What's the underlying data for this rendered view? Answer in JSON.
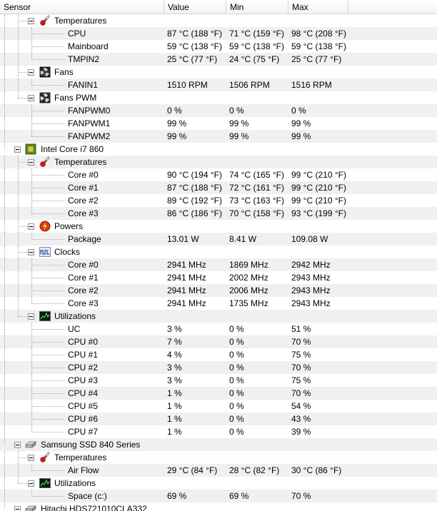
{
  "header": {
    "sensor": "Sensor",
    "value": "Value",
    "min": "Min",
    "max": "Max"
  },
  "rows": [
    {
      "type": "cat",
      "label": "Temperatures",
      "icon": "thermometer"
    },
    {
      "type": "leaf",
      "label": "CPU",
      "value": "87 °C  (188 °F)",
      "min": "71 °C  (159 °F)",
      "max": "98 °C  (208 °F)"
    },
    {
      "type": "leaf",
      "label": "Mainboard",
      "value": "59 °C  (138 °F)",
      "min": "59 °C  (138 °F)",
      "max": "59 °C  (138 °F)"
    },
    {
      "type": "leaf",
      "label": "TMPIN2",
      "value": "25 °C  (77 °F)",
      "min": "24 °C  (75 °F)",
      "max": "25 °C  (77 °F)",
      "last": true
    },
    {
      "type": "cat",
      "label": "Fans",
      "icon": "fan"
    },
    {
      "type": "leaf",
      "label": "FANIN1",
      "value": "1510 RPM",
      "min": "1506 RPM",
      "max": "1516 RPM",
      "last": true
    },
    {
      "type": "cat",
      "label": "Fans PWM",
      "icon": "fan-pwm",
      "lastCat": true
    },
    {
      "type": "leaf",
      "label": "FANPWM0",
      "value": "0 %",
      "min": "0 %",
      "max": "0 %"
    },
    {
      "type": "leaf",
      "label": "FANPWM1",
      "value": "99 %",
      "min": "99 %",
      "max": "99 %"
    },
    {
      "type": "leaf",
      "label": "FANPWM2",
      "value": "99 %",
      "min": "99 %",
      "max": "99 %",
      "last": true
    },
    {
      "type": "hw",
      "label": "Intel Core i7 860",
      "icon": "cpu-chip"
    },
    {
      "type": "cat",
      "label": "Temperatures",
      "icon": "thermometer"
    },
    {
      "type": "leaf",
      "label": "Core #0",
      "value": "90 °C  (194 °F)",
      "min": "74 °C  (165 °F)",
      "max": "99 °C  (210 °F)"
    },
    {
      "type": "leaf",
      "label": "Core #1",
      "value": "87 °C  (188 °F)",
      "min": "72 °C  (161 °F)",
      "max": "99 °C  (210 °F)"
    },
    {
      "type": "leaf",
      "label": "Core #2",
      "value": "89 °C  (192 °F)",
      "min": "73 °C  (163 °F)",
      "max": "99 °C  (210 °F)"
    },
    {
      "type": "leaf",
      "label": "Core #3",
      "value": "86 °C  (186 °F)",
      "min": "70 °C  (158 °F)",
      "max": "93 °C  (199 °F)",
      "last": true
    },
    {
      "type": "cat",
      "label": "Powers",
      "icon": "power"
    },
    {
      "type": "leaf",
      "label": "Package",
      "value": "13.01 W",
      "min": "8.41 W",
      "max": "109.08 W",
      "last": true
    },
    {
      "type": "cat",
      "label": "Clocks",
      "icon": "clock"
    },
    {
      "type": "leaf",
      "label": "Core #0",
      "value": "2941 MHz",
      "min": "1869 MHz",
      "max": "2942 MHz"
    },
    {
      "type": "leaf",
      "label": "Core #1",
      "value": "2941 MHz",
      "min": "2002 MHz",
      "max": "2943 MHz"
    },
    {
      "type": "leaf",
      "label": "Core #2",
      "value": "2941 MHz",
      "min": "2006 MHz",
      "max": "2943 MHz"
    },
    {
      "type": "leaf",
      "label": "Core #3",
      "value": "2941 MHz",
      "min": "1735 MHz",
      "max": "2943 MHz",
      "last": true
    },
    {
      "type": "cat",
      "label": "Utilizations",
      "icon": "load",
      "lastCat": true
    },
    {
      "type": "leaf",
      "label": "UC",
      "value": "3 %",
      "min": "0 %",
      "max": "51 %"
    },
    {
      "type": "leaf",
      "label": "CPU #0",
      "value": "7 %",
      "min": "0 %",
      "max": "70 %"
    },
    {
      "type": "leaf",
      "label": "CPU #1",
      "value": "4 %",
      "min": "0 %",
      "max": "75 %"
    },
    {
      "type": "leaf",
      "label": "CPU #2",
      "value": "3 %",
      "min": "0 %",
      "max": "70 %"
    },
    {
      "type": "leaf",
      "label": "CPU #3",
      "value": "3 %",
      "min": "0 %",
      "max": "75 %"
    },
    {
      "type": "leaf",
      "label": "CPU #4",
      "value": "1 %",
      "min": "0 %",
      "max": "70 %"
    },
    {
      "type": "leaf",
      "label": "CPU #5",
      "value": "1 %",
      "min": "0 %",
      "max": "54 %"
    },
    {
      "type": "leaf",
      "label": "CPU #6",
      "value": "1 %",
      "min": "0 %",
      "max": "43 %"
    },
    {
      "type": "leaf",
      "label": "CPU #7",
      "value": "1 %",
      "min": "0 %",
      "max": "39 %",
      "last": true
    },
    {
      "type": "hw",
      "label": "Samsung SSD 840 Series",
      "icon": "drive"
    },
    {
      "type": "cat",
      "label": "Temperatures",
      "icon": "thermometer"
    },
    {
      "type": "leaf",
      "label": "Air Flow",
      "value": "29 °C  (84 °F)",
      "min": "28 °C  (82 °F)",
      "max": "30 °C  (86 °F)",
      "last": true
    },
    {
      "type": "cat",
      "label": "Utilizations",
      "icon": "load",
      "lastCat": true
    },
    {
      "type": "leaf",
      "label": "Space (c:)",
      "value": "69 %",
      "min": "69 %",
      "max": "70 %",
      "last": true
    },
    {
      "type": "hw",
      "label": "Hitachi HDS721010CLA332",
      "icon": "drive"
    }
  ]
}
